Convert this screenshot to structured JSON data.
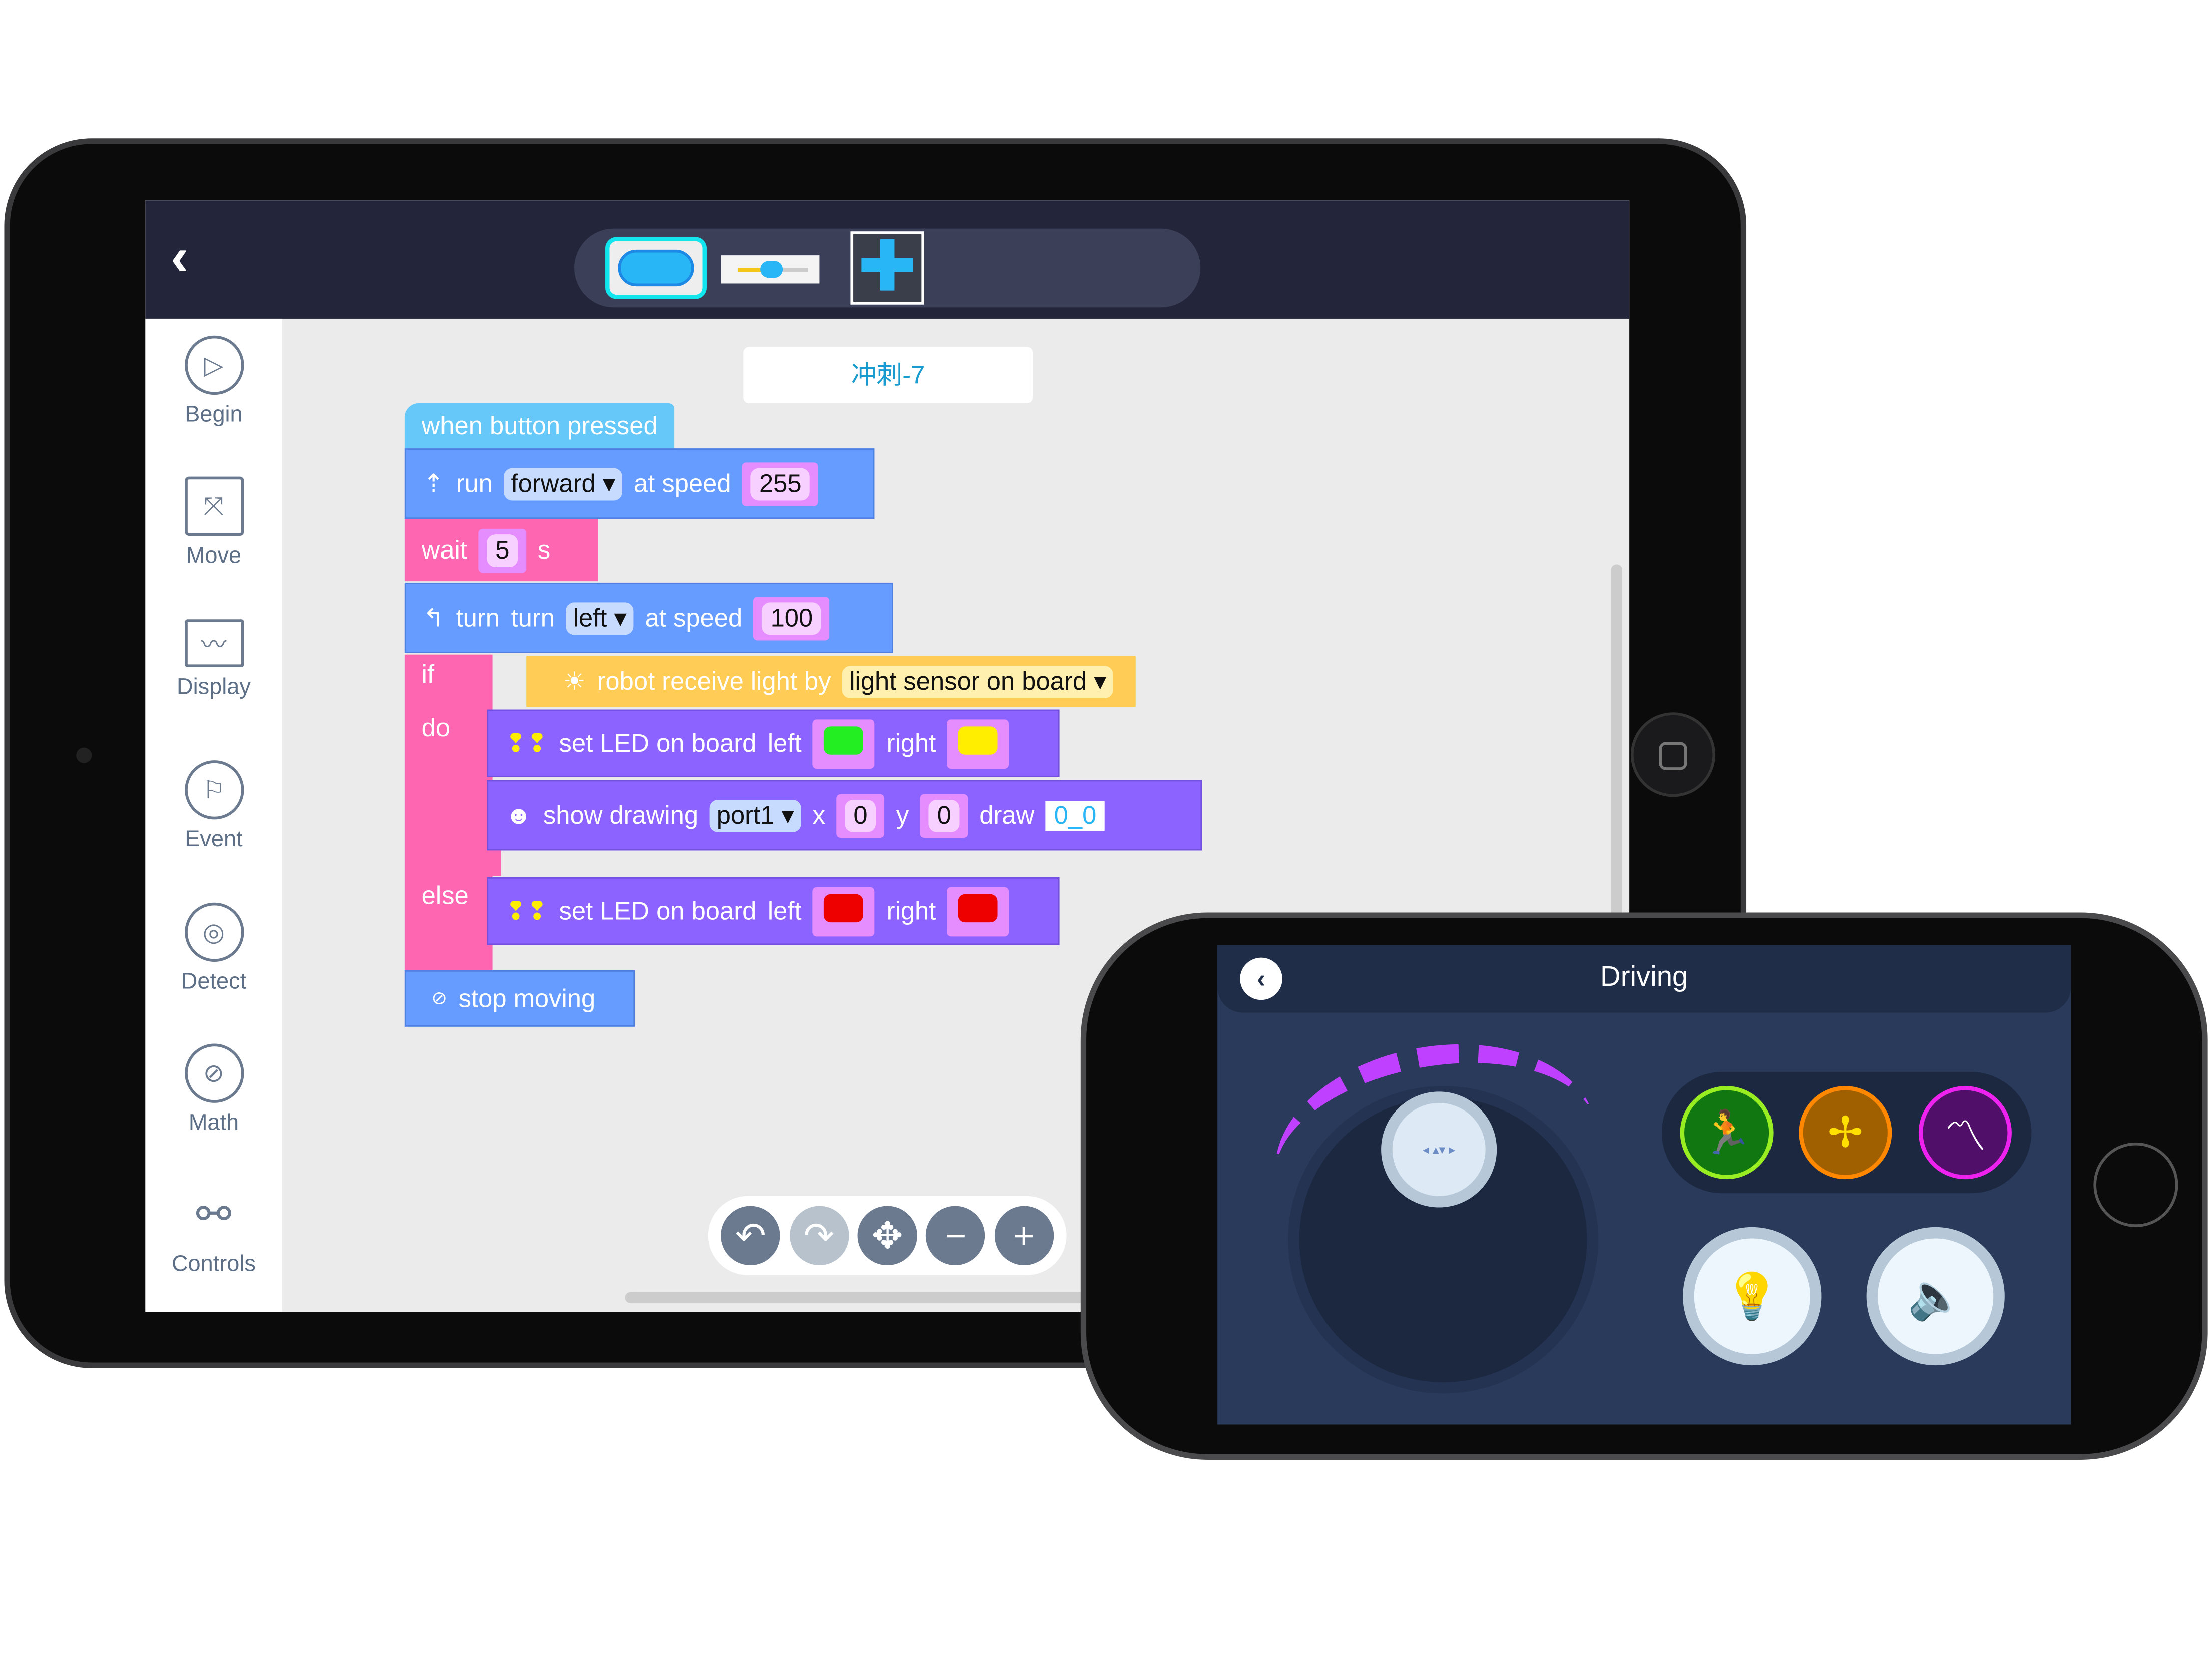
{
  "tablet": {
    "header": {
      "back_icon": "chevron-left-icon",
      "widgets": [
        "button-widget",
        "slider-widget",
        "dpad-widget"
      ]
    },
    "sidebar": {
      "items": [
        {
          "label": "Begin",
          "icon": "play-icon"
        },
        {
          "label": "Move",
          "icon": "move-icon"
        },
        {
          "label": "Display",
          "icon": "display-icon"
        },
        {
          "label": "Event",
          "icon": "flag-icon"
        },
        {
          "label": "Detect",
          "icon": "radar-icon"
        },
        {
          "label": "Math",
          "icon": "math-icon"
        },
        {
          "label": "Controls",
          "icon": "controls-icon"
        }
      ]
    },
    "project_title": "冲刺-7",
    "blocks": {
      "hat": "when button pressed",
      "run": {
        "label": "run",
        "direction": "forward",
        "at_speed": "at speed",
        "speed": "255"
      },
      "wait": {
        "label": "wait",
        "value": "5",
        "unit": "s"
      },
      "turn": {
        "label": "turn",
        "label2": "turn",
        "direction": "left",
        "at_speed": "at speed",
        "speed": "100"
      },
      "if": {
        "if_label": "if",
        "condition": "robot receive light by",
        "sensor": "light sensor on board",
        "do_label": "do",
        "else_label": "else"
      },
      "led1": {
        "label": "set LED on board",
        "left": "left",
        "right": "right",
        "left_color": "#22ee22",
        "right_color": "#ffee00"
      },
      "draw": {
        "label": "show drawing",
        "port": "port1",
        "x_label": "x",
        "x": "0",
        "y_label": "y",
        "y": "0",
        "draw_label": "draw",
        "face": "0_0"
      },
      "led2": {
        "label": "set LED on board",
        "left": "left",
        "right": "right",
        "left_color": "#ee0000",
        "right_color": "#ee0000"
      },
      "stop": "stop moving"
    },
    "toolbar": {
      "undo": "↶",
      "redo": "↷",
      "move": "✥",
      "zoom_out": "−",
      "zoom_in": "+"
    }
  },
  "phone": {
    "title": "Driving",
    "speed_level": 0.85,
    "skills": [
      {
        "icon": "running-man-icon",
        "color": "#99ee22"
      },
      {
        "icon": "pinwheel-icon",
        "color": "#ff8800"
      },
      {
        "icon": "pulse-icon",
        "color": "#ee22ee"
      }
    ],
    "buttons": [
      {
        "icon": "lightbulb-icon"
      },
      {
        "icon": "speaker-icon"
      }
    ]
  }
}
